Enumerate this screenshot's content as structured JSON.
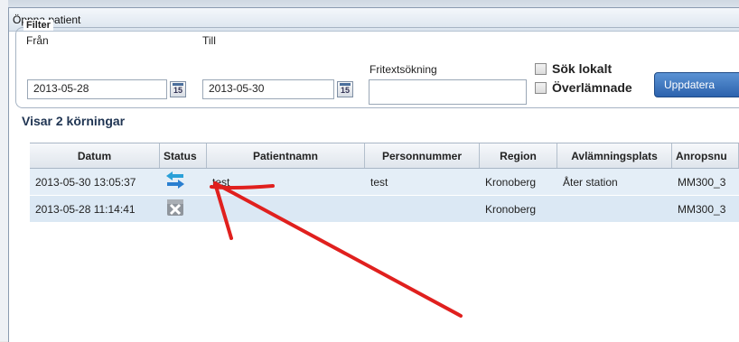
{
  "window": {
    "title": "Öppna patient"
  },
  "filter": {
    "legend": "Filter",
    "from_label": "Från",
    "from_value": "2013-05-28",
    "to_label": "Till",
    "to_value": "2013-05-30",
    "freetext_label": "Fritextsökning",
    "freetext_value": "",
    "calendar_day": "15",
    "search_local_label": "Sök lokalt",
    "handed_over_label": "Överlämnade",
    "update_button": "Uppdatera"
  },
  "results": {
    "heading": "Visar 2 körningar",
    "columns": [
      "Datum",
      "Status",
      "Patientnamn",
      "Personnummer",
      "Region",
      "Avlämningsplats",
      "Anropsnu"
    ],
    "rows": [
      {
        "datum": "2013-05-30 13:05:37",
        "status_icon": "transfer-arrows-icon",
        "patientnamn": "test",
        "personnummer": "test",
        "region": "Kronoberg",
        "avlamningsplats": "Åter station",
        "anropsnummer": "MM300_3"
      },
      {
        "datum": "2013-05-28 11:14:41",
        "status_icon": "cancelled-x-icon",
        "patientnamn": "",
        "personnummer": "",
        "region": "Kronoberg",
        "avlamningsplats": "",
        "anropsnummer": "MM300_3"
      }
    ]
  },
  "colors": {
    "annotation_arrow": "#e0201e",
    "button_blue": "#2c62ad",
    "row_bg": "#e4eef7"
  }
}
